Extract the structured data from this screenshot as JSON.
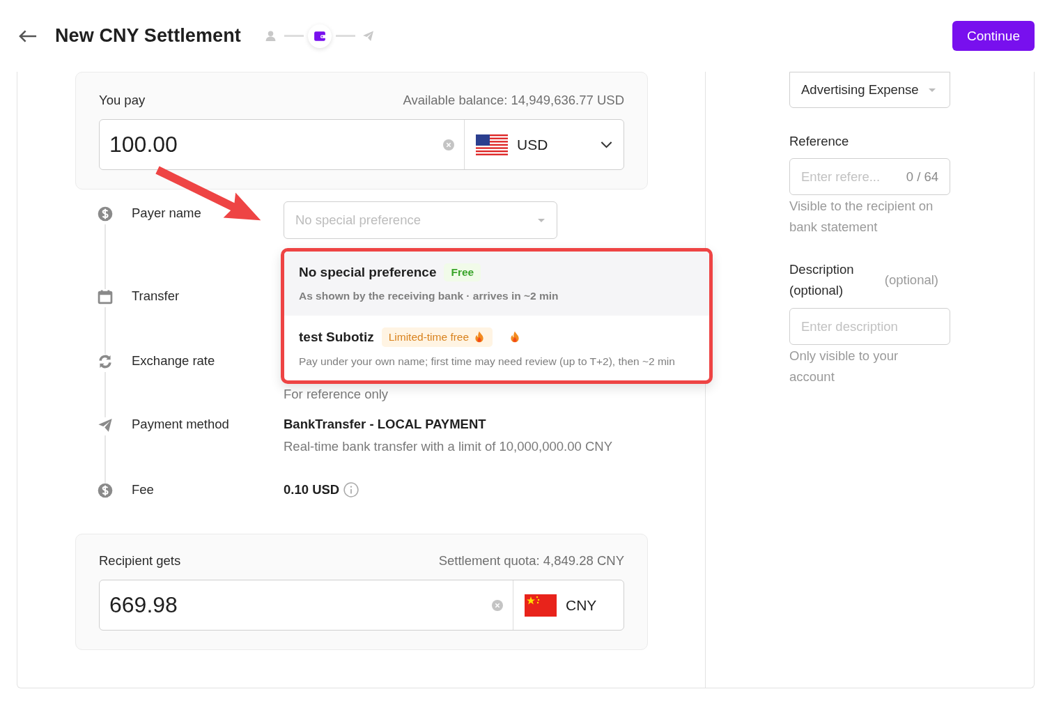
{
  "header": {
    "title": "New CNY Settlement",
    "steps": [
      {
        "kind": "person",
        "selected": false
      },
      {
        "kind": "wallet",
        "selected": true
      },
      {
        "kind": "send",
        "selected": false
      }
    ],
    "continue_button": "Continue"
  },
  "you_pay": {
    "label": "You pay",
    "balance": "Available balance: 14,949,636.77 USD",
    "amount": "100.00",
    "currency": "USD"
  },
  "details": [
    {
      "kind": "dollar",
      "label": "Payer name",
      "field": {
        "placeholder": "No special preference"
      }
    },
    {
      "kind": "calendar",
      "label": "Transfer"
    },
    {
      "kind": "exchange",
      "label": "Exchange rate",
      "note": "For reference only"
    },
    {
      "kind": "send",
      "label": "Payment method",
      "value": "BankTransfer - LOCAL PAYMENT",
      "note": "Real-time bank transfer with a limit of 10,000,000.00 CNY"
    },
    {
      "kind": "dollar",
      "label": "Fee",
      "value": "0.10 USD",
      "info": true
    }
  ],
  "dropdown": {
    "options": [
      {
        "title": "No special preference",
        "tag": {
          "text": "Free",
          "kind": "free"
        },
        "fire": false,
        "description": "As shown by the receiving bank · arrives in ~2 min",
        "selected": true
      },
      {
        "title": "test Subotiz",
        "tag": {
          "text": "Limited-time free",
          "kind": "promo"
        },
        "fire": true,
        "description": "Pay under your own name; first time may need review (up to T+2), then ~2 min",
        "selected": false
      }
    ]
  },
  "recipient_gets": {
    "label": "Recipient gets",
    "quota": "Settlement quota: 4,849.28 CNY",
    "amount": "669.98",
    "currency": "CNY"
  },
  "side": {
    "category": "Advertising Expense",
    "reference": {
      "label": "Reference",
      "placeholder": "Enter refere...",
      "counter": "0 / 64",
      "help": "Visible to the recipient on bank statement"
    },
    "description": {
      "label": "Description (optional)",
      "optional": "(optional)",
      "placeholder": "Enter description",
      "help": "Only visible to your account"
    }
  }
}
